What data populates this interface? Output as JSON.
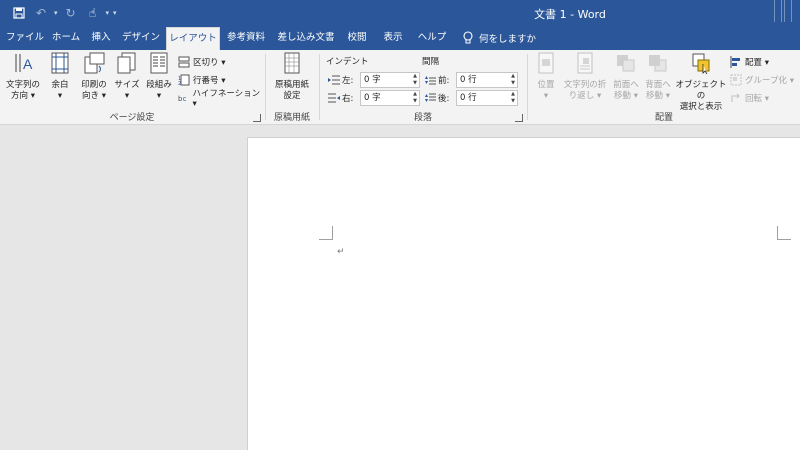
{
  "title_bar": {
    "document_title": "文書 1  -  Word",
    "qat_icons": [
      "save-icon",
      "undo-icon",
      "redo-icon",
      "touch-mode-icon"
    ]
  },
  "tabs": [
    {
      "label": "ファイル",
      "active": false
    },
    {
      "label": "ホーム",
      "active": false
    },
    {
      "label": "挿入",
      "active": false
    },
    {
      "label": "デザイン",
      "active": false
    },
    {
      "label": "レイアウト",
      "active": true
    },
    {
      "label": "参考資料",
      "active": false
    },
    {
      "label": "差し込み文書",
      "active": false
    },
    {
      "label": "校閲",
      "active": false
    },
    {
      "label": "表示",
      "active": false
    },
    {
      "label": "ヘルプ",
      "active": false
    }
  ],
  "tell_me": "何をしますか",
  "page_setup": {
    "group_label": "ページ設定",
    "text_direction": [
      "文字列の",
      "方向 ▾"
    ],
    "margins": [
      "余白",
      "▾"
    ],
    "orientation": [
      "印刷の",
      "向き ▾"
    ],
    "size": [
      "サイズ",
      "▾"
    ],
    "columns": [
      "段組み",
      "▾"
    ],
    "breaks": "区切り ▾",
    "line_numbers": "行番号 ▾",
    "hyphenation": "ハイフネーション ▾"
  },
  "genko": {
    "group_label": "原稿用紙",
    "button": [
      "原稿用紙",
      "設定"
    ]
  },
  "paragraph": {
    "group_label": "段落",
    "indent_heading": "インデント",
    "spacing_heading": "間隔",
    "left_label": "左:",
    "left_value": "0 字",
    "right_label": "右:",
    "right_value": "0 字",
    "before_label": "前:",
    "before_value": "0 行",
    "after_label": "後:",
    "after_value": "0 行"
  },
  "arrange": {
    "group_label": "配置",
    "position": [
      "位置",
      "▾"
    ],
    "wrap_text": [
      "文字列の折",
      "り返し ▾"
    ],
    "bring_forward": [
      "前面へ",
      "移動 ▾"
    ],
    "send_backward": [
      "背面へ",
      "移動 ▾"
    ],
    "selection_pane": [
      "オブジェクトの",
      "選択と表示"
    ],
    "align": "配置 ▾",
    "group": "グループ化 ▾",
    "rotate": "回転 ▾"
  },
  "document": {
    "paragraph_mark": "↵"
  },
  "colors": {
    "word_blue": "#2b579a",
    "ribbon_bg": "#f3f3f3",
    "canvas_bg": "#e6e6e6",
    "disabled_text": "#a6a6a6"
  }
}
